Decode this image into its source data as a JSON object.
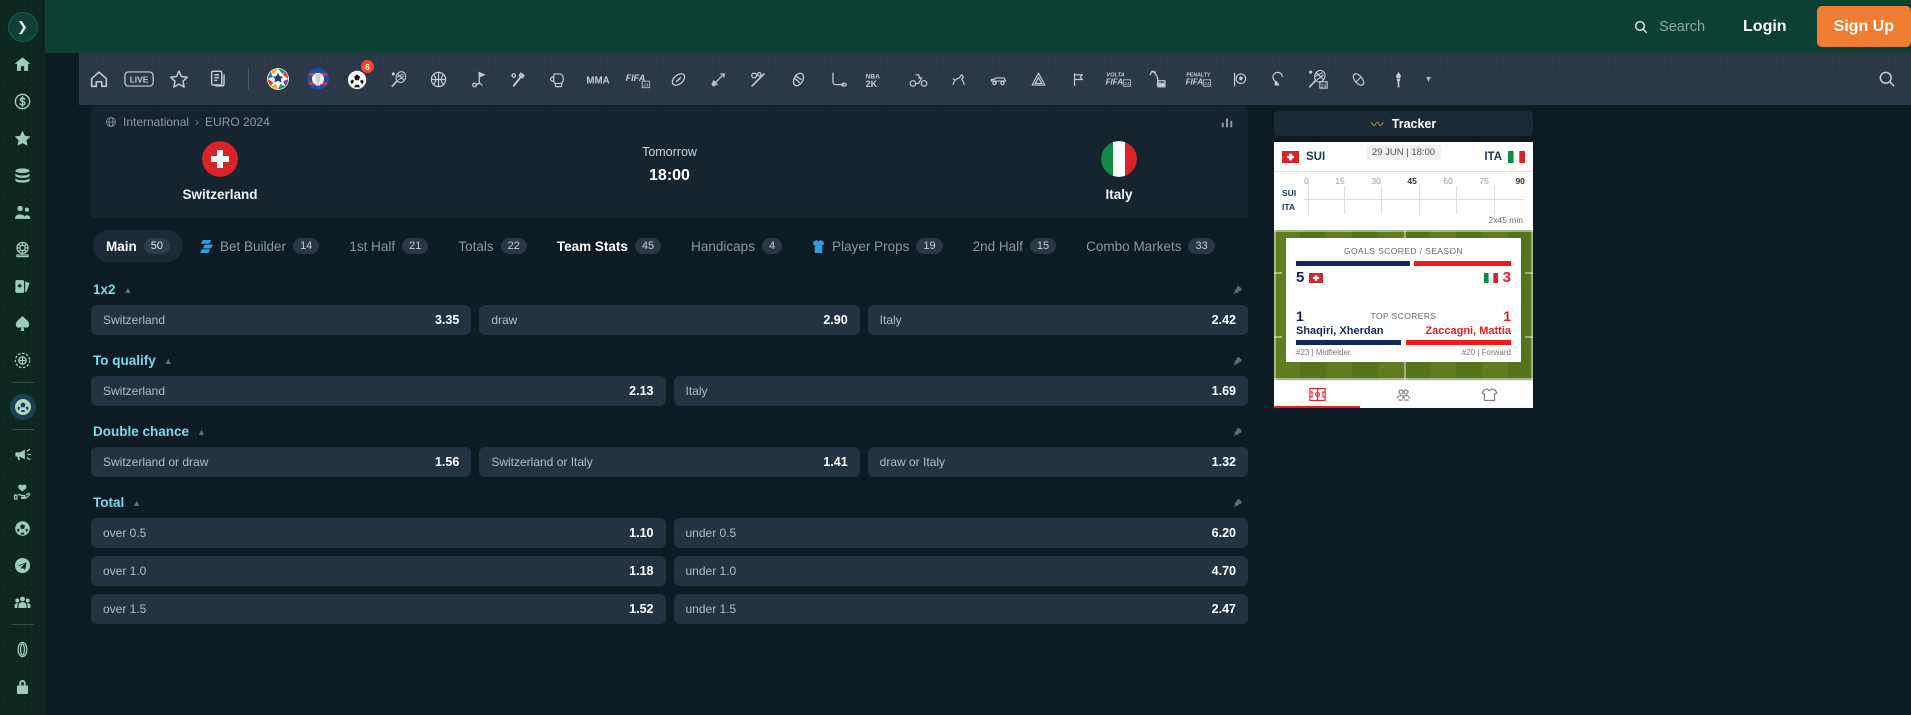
{
  "header": {
    "search_placeholder": "Search",
    "login_label": "Login",
    "signup_label": "Sign Up",
    "accent_color": "#f07d34",
    "bg_color": "#0c4034"
  },
  "left_rail": {
    "toggle_icon": "chevron-right-icon",
    "items": [
      {
        "icon": "home-icon",
        "name": "home"
      },
      {
        "icon": "dollar-coin-icon",
        "name": "promotions"
      },
      {
        "icon": "star-icon",
        "name": "favourites"
      },
      {
        "icon": "coins-stack-icon",
        "name": "coins"
      },
      {
        "icon": "users-icon",
        "name": "friends"
      },
      {
        "icon": "roulette-icon",
        "name": "roulette"
      },
      {
        "icon": "cards-icon",
        "name": "cards"
      },
      {
        "icon": "spade-icon",
        "name": "poker"
      },
      {
        "icon": "chip-icon",
        "name": "casino-chip"
      },
      {
        "icon": "soccer-ball-circle-icon",
        "name": "sports",
        "active": true
      },
      {
        "icon": "megaphone-icon",
        "name": "announcements"
      },
      {
        "icon": "hand-heart-icon",
        "name": "responsible-gaming"
      },
      {
        "icon": "soccer-ball-icon",
        "name": "football"
      },
      {
        "icon": "telegram-icon",
        "name": "telegram"
      },
      {
        "icon": "group-icon",
        "name": "community"
      },
      {
        "icon": "coin-icon",
        "name": "currency"
      },
      {
        "icon": "lock-icon",
        "name": "security"
      }
    ]
  },
  "sports_nav": {
    "items": [
      {
        "name": "home",
        "icon": "home-outline-icon"
      },
      {
        "name": "live",
        "icon": "live-badge-icon"
      },
      {
        "name": "favourites",
        "icon": "star-outline-icon"
      },
      {
        "name": "bet-slip",
        "icon": "documents-icon"
      },
      {
        "name": "euro-2024",
        "icon": "euro-trophy-emblem"
      },
      {
        "name": "copa-america",
        "icon": "copa-america-emblem"
      },
      {
        "name": "football-hot",
        "icon": "football-hot-emblem",
        "badge": "6"
      },
      {
        "name": "tennis",
        "icon": "tennis-racket-icon"
      },
      {
        "name": "basketball",
        "icon": "basketball-icon"
      },
      {
        "name": "golf",
        "icon": "golf-icon"
      },
      {
        "name": "cricket",
        "icon": "cricket-icon"
      },
      {
        "name": "boxing",
        "icon": "boxing-glove-icon"
      },
      {
        "name": "mma",
        "icon": "mma-icon"
      },
      {
        "name": "fifa-24",
        "icon": "fifa24-icon"
      },
      {
        "name": "rugby",
        "icon": "rugby-icon"
      },
      {
        "name": "darts",
        "icon": "darts-icon"
      },
      {
        "name": "snooker",
        "icon": "snooker-icon"
      },
      {
        "name": "baseball",
        "icon": "baseball-bat-icon"
      },
      {
        "name": "ice-hockey",
        "icon": "ice-hockey-icon"
      },
      {
        "name": "nba2k",
        "icon": "nba2k-icon"
      },
      {
        "name": "cycling",
        "icon": "cycling-icon"
      },
      {
        "name": "horse-racing",
        "icon": "horse-racing-icon"
      },
      {
        "name": "motorsport",
        "icon": "motorsport-icon"
      },
      {
        "name": "handball",
        "icon": "handball-icon"
      },
      {
        "name": "volta-fifa-24",
        "icon": "volta-fifa24-icon"
      },
      {
        "name": "archery",
        "icon": "archery-icon"
      },
      {
        "name": "penalty-fifa-24",
        "icon": "penalty-fifa24-icon"
      },
      {
        "name": "futsal",
        "icon": "futsal-icon"
      },
      {
        "name": "american-football",
        "icon": "american-football-icon"
      },
      {
        "name": "badminton-24",
        "icon": "badminton24-icon"
      },
      {
        "name": "aussie-rules",
        "icon": "aussie-rules-icon"
      },
      {
        "name": "olympics",
        "icon": "torch-icon"
      }
    ],
    "more_caret": "▾",
    "search_icon": "search-icon"
  },
  "event": {
    "breadcrumb": {
      "globe_icon": "globe-icon",
      "region": "International",
      "separator": "›",
      "competition": "EURO 2024"
    },
    "stats_icon": "bar-chart-icon",
    "home_team": "Switzerland",
    "away_team": "Italy",
    "when_label": "Tomorrow",
    "kickoff_time": "18:00"
  },
  "tabs": [
    {
      "label": "Main",
      "count": "50",
      "state": "active",
      "icon": null
    },
    {
      "label": "Bet Builder",
      "count": "14",
      "state": "normal",
      "icon": "bet-builder-icon"
    },
    {
      "label": "1st Half",
      "count": "21",
      "state": "normal",
      "icon": null
    },
    {
      "label": "Totals",
      "count": "22",
      "state": "normal",
      "icon": null
    },
    {
      "label": "Team Stats",
      "count": "45",
      "state": "current",
      "icon": null
    },
    {
      "label": "Handicaps",
      "count": "4",
      "state": "normal",
      "icon": null
    },
    {
      "label": "Player Props",
      "count": "19",
      "state": "normal",
      "icon": "jersey-icon"
    },
    {
      "label": "2nd Half",
      "count": "15",
      "state": "normal",
      "icon": null
    },
    {
      "label": "Combo Markets",
      "count": "33",
      "state": "normal",
      "icon": null
    }
  ],
  "markets": [
    {
      "title": "1x2",
      "collapse_caret": "▲",
      "pin_icon": "pin-icon",
      "rows": [
        [
          {
            "label": "Switzerland",
            "odds": "3.35"
          },
          {
            "label": "draw",
            "odds": "2.90"
          },
          {
            "label": "Italy",
            "odds": "2.42"
          }
        ]
      ]
    },
    {
      "title": "To qualify",
      "collapse_caret": "▲",
      "pin_icon": "pin-icon",
      "rows": [
        [
          {
            "label": "Switzerland",
            "odds": "2.13"
          },
          {
            "label": "Italy",
            "odds": "1.69"
          }
        ]
      ]
    },
    {
      "title": "Double chance",
      "collapse_caret": "▲",
      "pin_icon": "pin-icon",
      "rows": [
        [
          {
            "label": "Switzerland or draw",
            "odds": "1.56"
          },
          {
            "label": "Switzerland or Italy",
            "odds": "1.41"
          },
          {
            "label": "draw or Italy",
            "odds": "1.32"
          }
        ]
      ]
    },
    {
      "title": "Total",
      "collapse_caret": "▲",
      "pin_icon": "pin-icon",
      "rows": [
        [
          {
            "label": "over 0.5",
            "odds": "1.10"
          },
          {
            "label": "under 0.5",
            "odds": "6.20"
          }
        ],
        [
          {
            "label": "over 1.0",
            "odds": "1.18"
          },
          {
            "label": "under 1.0",
            "odds": "4.70"
          }
        ],
        [
          {
            "label": "over 1.5",
            "odds": "1.52"
          },
          {
            "label": "under 1.5",
            "odds": "2.47"
          }
        ]
      ]
    }
  ],
  "tracker": {
    "button_label": "Tracker",
    "button_icon": "line-chart-icon",
    "home_abbr": "SUI",
    "away_abbr": "ITA",
    "kickoff_badge": "29 JUN | 18:00",
    "timeline": {
      "ticks": [
        "0",
        "15",
        "30",
        "45",
        "60",
        "75",
        "90"
      ],
      "rows": [
        "SUI",
        "ITA"
      ],
      "note": "2x45 min"
    },
    "goals_panel": {
      "title": "GOALS SCORED / SEASON",
      "home_value": "5",
      "away_value": "3"
    },
    "scorers_panel": {
      "title": "TOP SCORERS",
      "home_goals": "1",
      "away_goals": "1",
      "home_player": "Shaqiri, Xherdan",
      "away_player": "Zaccagni, Mattia",
      "home_meta": "#23 | Midfielder",
      "away_meta": "#20 | Forward"
    },
    "tabs": [
      {
        "name": "pitch-tab",
        "icon": "pitch-icon",
        "active": true
      },
      {
        "name": "lineup-tab",
        "icon": "lineup-icon",
        "active": false
      },
      {
        "name": "kit-tab",
        "icon": "jersey-icon",
        "active": false
      }
    ],
    "colors": {
      "home": "#13275e",
      "away": "#f21b1b"
    }
  }
}
